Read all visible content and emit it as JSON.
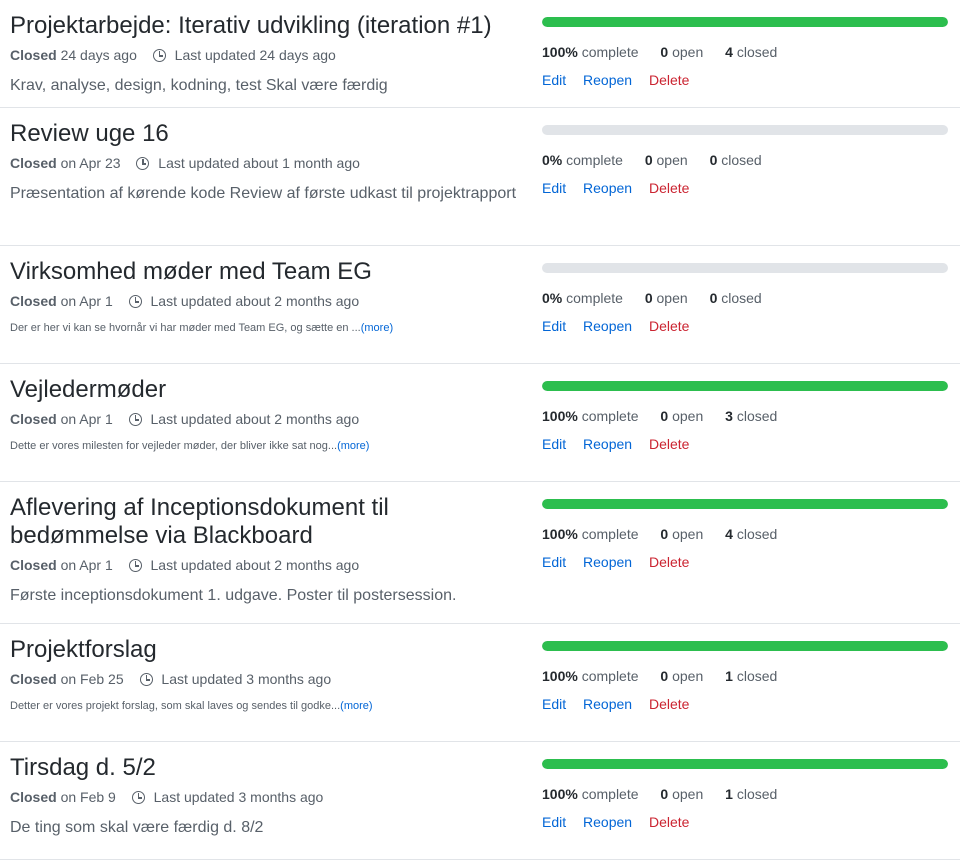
{
  "labels": {
    "closed": "Closed",
    "last_updated": "Last updated",
    "complete": "complete",
    "open": "open",
    "closed_count": "closed",
    "edit": "Edit",
    "reopen": "Reopen",
    "delete": "Delete",
    "more": "(more)"
  },
  "milestones": [
    {
      "title": "Projektarbejde: Iterativ udvikling (iteration #1)",
      "closed_when": "24 days ago",
      "updated_when": "24 days ago",
      "description": "Krav, analyse, design, kodning, test Skal være færdig",
      "truncated": false,
      "percent": "100%",
      "progress": 1.0,
      "open": "0",
      "closed": "4"
    },
    {
      "title": "Review uge 16",
      "closed_when": "on Apr 23",
      "updated_when": "about 1 month ago",
      "description": "Præsentation af kørende kode Review af første udkast til projektrapport",
      "truncated": false,
      "percent": "0%",
      "progress": 0.0,
      "open": "0",
      "closed": "0"
    },
    {
      "title": "Virksomhed møder med Team EG",
      "closed_when": "on Apr 1",
      "updated_when": "about 2 months ago",
      "description": "Der er her vi kan se hvornår vi har møder med Team EG, og sætte en ...",
      "truncated": true,
      "percent": "0%",
      "progress": 0.0,
      "open": "0",
      "closed": "0"
    },
    {
      "title": "Vejledermøder",
      "closed_when": "on Apr 1",
      "updated_when": "about 2 months ago",
      "description": "Dette er vores milesten for vejleder møder, der bliver ikke sat nog...",
      "truncated": true,
      "percent": "100%",
      "progress": 1.0,
      "open": "0",
      "closed": "3"
    },
    {
      "title": "Aflevering af Inceptionsdokument til bedømmelse via Blackboard",
      "closed_when": "on Apr 1",
      "updated_when": "about 2 months ago",
      "description": "Første inceptionsdokument 1. udgave. Poster til postersession.",
      "truncated": false,
      "percent": "100%",
      "progress": 1.0,
      "open": "0",
      "closed": "4"
    },
    {
      "title": "Projektforslag",
      "closed_when": "on Feb 25",
      "updated_when": "3 months ago",
      "description": "Detter er vores projekt forslag, som skal laves og sendes til godke...",
      "truncated": true,
      "percent": "100%",
      "progress": 1.0,
      "open": "0",
      "closed": "1"
    },
    {
      "title": "Tirsdag d. 5/2",
      "closed_when": "on Feb 9",
      "updated_when": "3 months ago",
      "description": "De ting som skal være færdig d. 8/2",
      "truncated": false,
      "percent": "100%",
      "progress": 1.0,
      "open": "0",
      "closed": "1"
    }
  ]
}
